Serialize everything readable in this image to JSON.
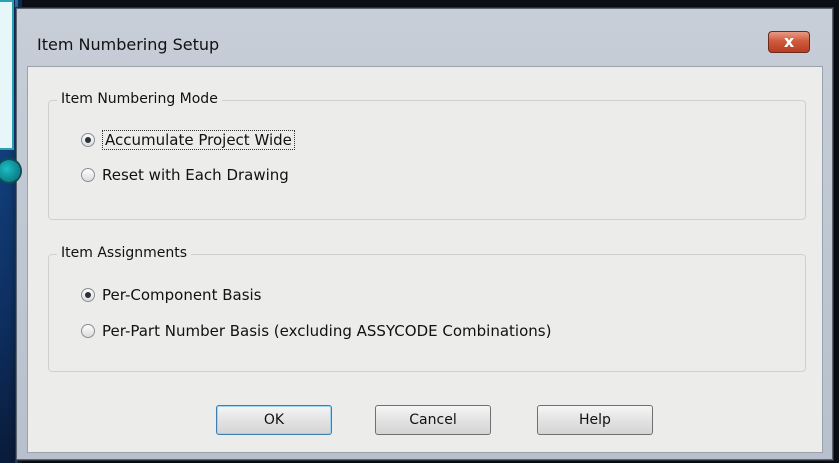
{
  "window": {
    "title": "Item Numbering Setup",
    "close_label": "x"
  },
  "groups": {
    "mode": {
      "legend": "Item Numbering Mode",
      "options": [
        {
          "label": "Accumulate Project Wide",
          "checked": true
        },
        {
          "label": "Reset with Each Drawing",
          "checked": false
        }
      ]
    },
    "assignments": {
      "legend": "Item Assignments",
      "options": [
        {
          "label": "Per-Component Basis",
          "checked": true
        },
        {
          "label": "Per-Part Number Basis (excluding ASSYCODE Combinations)",
          "checked": false
        }
      ]
    }
  },
  "buttons": {
    "ok": "OK",
    "cancel": "Cancel",
    "help": "Help"
  },
  "colors": {
    "close_button": "#c8482b",
    "dialog_background": "#ececeb",
    "frame": "#bcc4cf",
    "callout_accent": "#2aa0b5"
  }
}
